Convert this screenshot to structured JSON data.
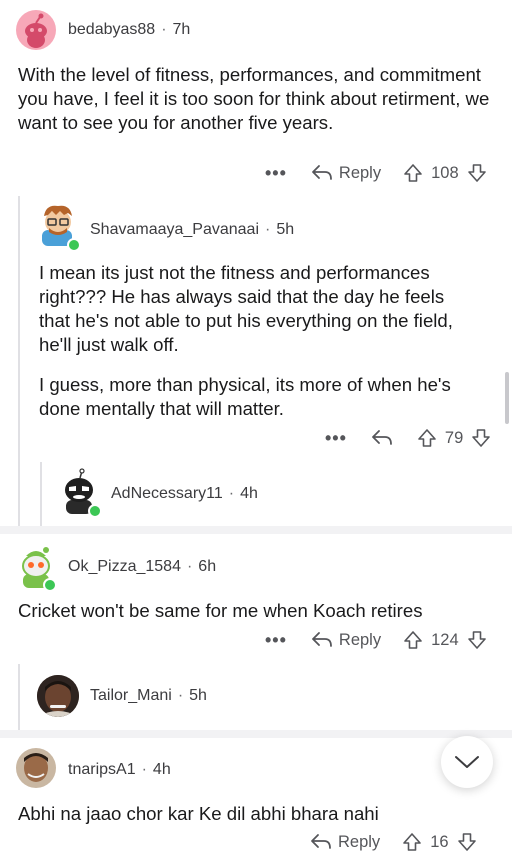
{
  "comments": [
    {
      "user": "bedabyas88",
      "time": "7h",
      "text": "With the level of fitness, performances, and commitment you have, I feel it is too soon for think about retirment, we want to see you for another five years.",
      "reply_label": "Reply",
      "votes": "108"
    },
    {
      "user": "Shavamaaya_Pavanaai",
      "time": "5h",
      "text_p1": "I mean its just not the fitness and performances right??? He has always said that the day he feels that he's not able to put his everything on the field, he'll just walk off.",
      "text_p2": "I guess, more than physical, its more of when he's done mentally that will matter.",
      "votes": "79"
    },
    {
      "user": "AdNecessary11",
      "time": "4h"
    },
    {
      "user": "Ok_Pizza_1584",
      "time": "6h",
      "text": "Cricket won't be same for me when Koach retires",
      "reply_label": "Reply",
      "votes": "124"
    },
    {
      "user": "Tailor_Mani",
      "time": "5h"
    },
    {
      "user": "tnaripsA1",
      "time": "4h",
      "text": "Abhi na jaao chor kar Ke dil abhi bhara nahi",
      "reply_label": "Reply",
      "votes": "16"
    }
  ],
  "more_icon": "•••",
  "colors": {
    "online": "#3cc755",
    "avatar_pink": "#f7a8b8"
  }
}
